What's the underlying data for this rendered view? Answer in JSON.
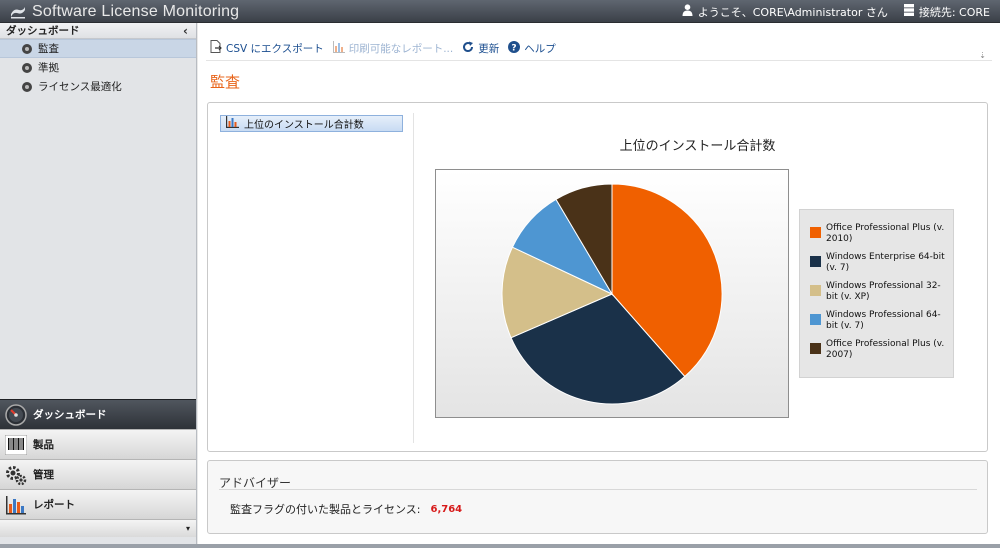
{
  "app": {
    "title": "Software License Monitoring"
  },
  "topbar": {
    "welcome": "ようこそ、CORE\\Administrator さん",
    "connection": "接続先: CORE"
  },
  "sidebar": {
    "header": "ダッシュボード",
    "items": [
      {
        "label": "監査",
        "active": true
      },
      {
        "label": "準拠",
        "active": false
      },
      {
        "label": "ライセンス最適化",
        "active": false
      }
    ],
    "modules": [
      {
        "label": "ダッシュボード",
        "icon": "gauge-icon"
      },
      {
        "label": "製品",
        "icon": "barcode-icon"
      },
      {
        "label": "管理",
        "icon": "gears-icon"
      },
      {
        "label": "レポート",
        "icon": "bar-chart-icon"
      }
    ]
  },
  "toolbar": {
    "export_csv": "CSV にエクスポート",
    "printable_report": "印刷可能なレポート...",
    "refresh": "更新",
    "help": "ヘルプ"
  },
  "page": {
    "title": "監査"
  },
  "chart_list": {
    "items": [
      "上位のインストール合計数"
    ]
  },
  "chart_data": {
    "type": "pie",
    "title": "上位のインストール合計数",
    "categories": [
      "Office Professional Plus (v. 2010)",
      "Windows Enterprise 64-bit (v. 7)",
      "Windows Professional 32-bit (v. XP)",
      "Windows Professional 64-bit (v. 7)",
      "Office Professional Plus (v. 2007)"
    ],
    "values": [
      38.5,
      30,
      13.5,
      9.5,
      8.5
    ],
    "colors": [
      "#f06000",
      "#1a3149",
      "#d4bf8a",
      "#4e96d2",
      "#4a3218"
    ],
    "legend": "right"
  },
  "advisor": {
    "title": "アドバイザー",
    "label": "監査フラグの付いた製品とライセンス:",
    "value": "6,764"
  }
}
